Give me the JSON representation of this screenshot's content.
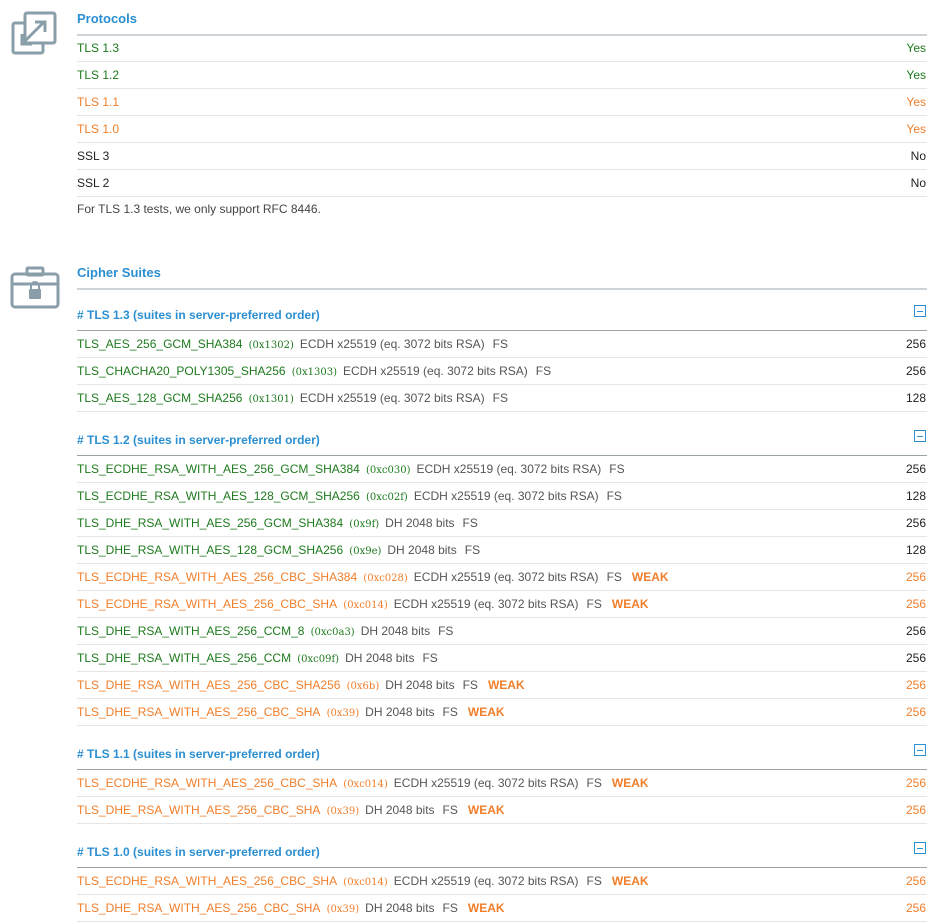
{
  "protocols": {
    "title": "Protocols",
    "icon": "expand-arrows-icon",
    "rows": [
      {
        "name": "TLS 1.3",
        "value": "Yes",
        "status": "green"
      },
      {
        "name": "TLS 1.2",
        "value": "Yes",
        "status": "green"
      },
      {
        "name": "TLS 1.1",
        "value": "Yes",
        "status": "orange"
      },
      {
        "name": "TLS 1.0",
        "value": "Yes",
        "status": "orange"
      },
      {
        "name": "SSL 3",
        "value": "No",
        "status": "black"
      },
      {
        "name": "SSL 2",
        "value": "No",
        "status": "black"
      }
    ],
    "note": "For TLS 1.3 tests, we only support RFC 8446."
  },
  "cipher_suites": {
    "title": "Cipher Suites",
    "icon": "briefcase-lock-icon",
    "groups": [
      {
        "title": "# TLS 1.3 (suites in server-preferred order)",
        "suites": [
          {
            "name": "TLS_AES_256_GCM_SHA384",
            "code": "(0x1302)",
            "kx": "ECDH x25519 (eq. 3072 bits RSA)",
            "fs": "FS",
            "weak": "",
            "bits": "256",
            "status": "green"
          },
          {
            "name": "TLS_CHACHA20_POLY1305_SHA256",
            "code": "(0x1303)",
            "kx": "ECDH x25519 (eq. 3072 bits RSA)",
            "fs": "FS",
            "weak": "",
            "bits": "256",
            "status": "green"
          },
          {
            "name": "TLS_AES_128_GCM_SHA256",
            "code": "(0x1301)",
            "kx": "ECDH x25519 (eq. 3072 bits RSA)",
            "fs": "FS",
            "weak": "",
            "bits": "128",
            "status": "green"
          }
        ]
      },
      {
        "title": "# TLS 1.2 (suites in server-preferred order)",
        "suites": [
          {
            "name": "TLS_ECDHE_RSA_WITH_AES_256_GCM_SHA384",
            "code": "(0xc030)",
            "kx": "ECDH x25519 (eq. 3072 bits RSA)",
            "fs": "FS",
            "weak": "",
            "bits": "256",
            "status": "green"
          },
          {
            "name": "TLS_ECDHE_RSA_WITH_AES_128_GCM_SHA256",
            "code": "(0xc02f)",
            "kx": "ECDH x25519 (eq. 3072 bits RSA)",
            "fs": "FS",
            "weak": "",
            "bits": "128",
            "status": "green"
          },
          {
            "name": "TLS_DHE_RSA_WITH_AES_256_GCM_SHA384",
            "code": "(0x9f)",
            "kx": "DH 2048 bits",
            "fs": "FS",
            "weak": "",
            "bits": "256",
            "status": "green"
          },
          {
            "name": "TLS_DHE_RSA_WITH_AES_128_GCM_SHA256",
            "code": "(0x9e)",
            "kx": "DH 2048 bits",
            "fs": "FS",
            "weak": "",
            "bits": "128",
            "status": "green"
          },
          {
            "name": "TLS_ECDHE_RSA_WITH_AES_256_CBC_SHA384",
            "code": "(0xc028)",
            "kx": "ECDH x25519 (eq. 3072 bits RSA)",
            "fs": "FS",
            "weak": "WEAK",
            "bits": "256",
            "status": "orange"
          },
          {
            "name": "TLS_ECDHE_RSA_WITH_AES_256_CBC_SHA",
            "code": "(0xc014)",
            "kx": "ECDH x25519 (eq. 3072 bits RSA)",
            "fs": "FS",
            "weak": "WEAK",
            "bits": "256",
            "status": "orange"
          },
          {
            "name": "TLS_DHE_RSA_WITH_AES_256_CCM_8",
            "code": "(0xc0a3)",
            "kx": "DH 2048 bits",
            "fs": "FS",
            "weak": "",
            "bits": "256",
            "status": "green"
          },
          {
            "name": "TLS_DHE_RSA_WITH_AES_256_CCM",
            "code": "(0xc09f)",
            "kx": "DH 2048 bits",
            "fs": "FS",
            "weak": "",
            "bits": "256",
            "status": "green"
          },
          {
            "name": "TLS_DHE_RSA_WITH_AES_256_CBC_SHA256",
            "code": "(0x6b)",
            "kx": "DH 2048 bits",
            "fs": "FS",
            "weak": "WEAK",
            "bits": "256",
            "status": "orange"
          },
          {
            "name": "TLS_DHE_RSA_WITH_AES_256_CBC_SHA",
            "code": "(0x39)",
            "kx": "DH 2048 bits",
            "fs": "FS",
            "weak": "WEAK",
            "bits": "256",
            "status": "orange"
          }
        ]
      },
      {
        "title": "# TLS 1.1 (suites in server-preferred order)",
        "suites": [
          {
            "name": "TLS_ECDHE_RSA_WITH_AES_256_CBC_SHA",
            "code": "(0xc014)",
            "kx": "ECDH x25519 (eq. 3072 bits RSA)",
            "fs": "FS",
            "weak": "WEAK",
            "bits": "256",
            "status": "orange"
          },
          {
            "name": "TLS_DHE_RSA_WITH_AES_256_CBC_SHA",
            "code": "(0x39)",
            "kx": "DH 2048 bits",
            "fs": "FS",
            "weak": "WEAK",
            "bits": "256",
            "status": "orange"
          }
        ]
      },
      {
        "title": "# TLS 1.0 (suites in server-preferred order)",
        "suites": [
          {
            "name": "TLS_ECDHE_RSA_WITH_AES_256_CBC_SHA",
            "code": "(0xc014)",
            "kx": "ECDH x25519 (eq. 3072 bits RSA)",
            "fs": "FS",
            "weak": "WEAK",
            "bits": "256",
            "status": "orange"
          },
          {
            "name": "TLS_DHE_RSA_WITH_AES_256_CBC_SHA",
            "code": "(0x39)",
            "kx": "DH 2048 bits",
            "fs": "FS",
            "weak": "WEAK",
            "bits": "256",
            "status": "orange"
          }
        ]
      }
    ]
  },
  "colors": {
    "green": "#1d7a1d",
    "orange": "#f07e2a",
    "accent": "#2b8fd1",
    "icon": "#8a9ea9"
  }
}
